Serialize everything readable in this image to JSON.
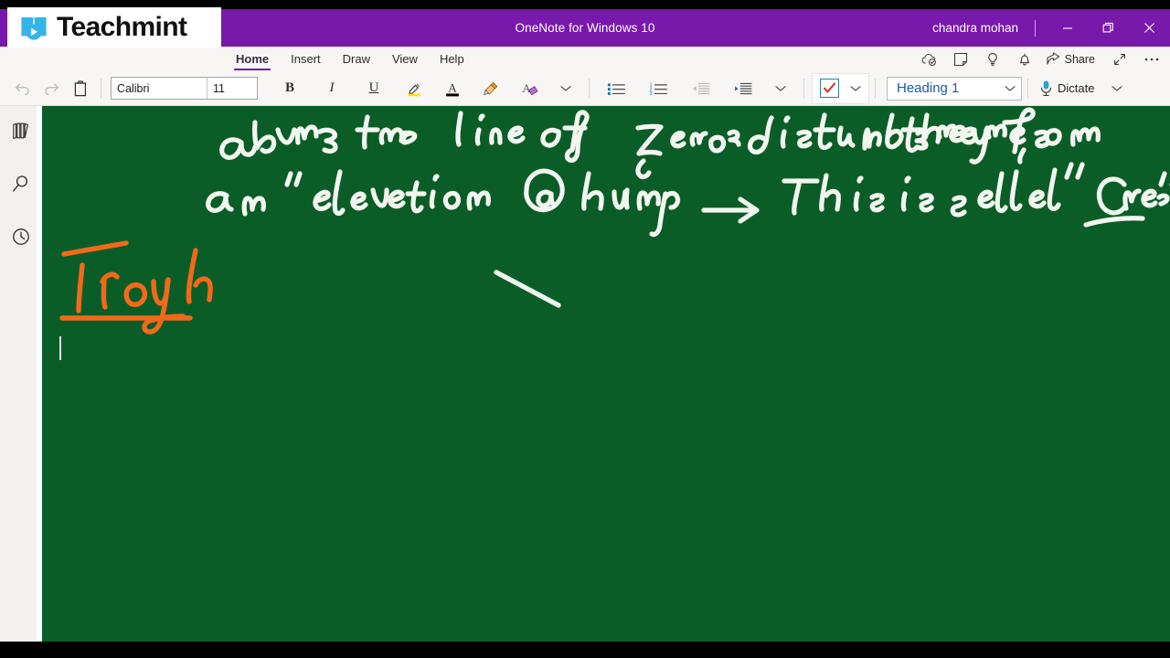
{
  "window": {
    "title": "OneNote for Windows 10",
    "account": "chandra mohan",
    "minimize_label": "Minimize",
    "restore_label": "Restore",
    "close_label": "Close"
  },
  "brand": {
    "name": "Teachmint",
    "logo_icon": "book-play-icon"
  },
  "ribbon": {
    "tabs": [
      {
        "label": "Home",
        "active": true
      },
      {
        "label": "Insert",
        "active": false
      },
      {
        "label": "Draw",
        "active": false
      },
      {
        "label": "View",
        "active": false
      },
      {
        "label": "Help",
        "active": false
      }
    ],
    "right_actions": [
      {
        "label": "Sync",
        "icon": "cloud-sync-icon"
      },
      {
        "label": "Sticky Notes",
        "icon": "sticky-note-icon"
      },
      {
        "label": "Tell me what you want to do",
        "icon": "lightbulb-icon"
      },
      {
        "label": "Notifications",
        "icon": "bell-icon"
      }
    ],
    "share_label": "Share",
    "share_icon": "share-icon",
    "expand_icon": "expand-arrow-icon",
    "more_icon": "ellipsis-icon"
  },
  "toolbar": {
    "undo": {
      "label": "Undo",
      "icon": "undo-icon",
      "enabled": false
    },
    "redo": {
      "label": "Redo",
      "icon": "redo-icon",
      "enabled": false
    },
    "paste": {
      "label": "Paste",
      "icon": "clipboard-icon"
    },
    "font_name": "Calibri",
    "font_size": "11",
    "bold": "B",
    "italic": "I",
    "underline": "U",
    "highlight": {
      "label": "Text Highlight Color",
      "icon": "highlighter-icon",
      "color": "#ffe400"
    },
    "font_color": {
      "label": "Font Color",
      "icon": "font-color-icon",
      "color": "#000000"
    },
    "format_painter": {
      "label": "Format Painter",
      "icon": "format-painter-icon",
      "color": "#e09a2b"
    },
    "clear_formatting": {
      "label": "Clear Formatting",
      "icon": "clear-formatting-icon",
      "color": "#8b3fa8"
    },
    "font_more": "More font options",
    "bullets": {
      "label": "Bullets",
      "icon": "bullet-list-icon"
    },
    "numbering": {
      "label": "Numbering",
      "icon": "numbered-list-icon"
    },
    "decrease_indent": {
      "label": "Decrease Indent",
      "icon": "decrease-indent-icon",
      "enabled": false
    },
    "increase_indent": {
      "label": "Increase Indent",
      "icon": "increase-indent-icon",
      "enabled": true
    },
    "paragraph_more": "More paragraph options",
    "todo_tag": {
      "label": "To Do Tag",
      "icon": "checkbox-check-icon",
      "check_color": "#d9342b",
      "box_color": "#2e7d9a"
    },
    "tags_more": "More tags",
    "style": "Heading 1",
    "style_more": "Styles dropdown",
    "dictate": {
      "label": "Dictate",
      "icon": "microphone-icon"
    },
    "dictate_more": "Dictate options"
  },
  "rail": {
    "items": [
      {
        "label": "Notebooks",
        "icon": "notebooks-icon"
      },
      {
        "label": "Search",
        "icon": "search-icon"
      },
      {
        "label": "Recent Notes",
        "icon": "clock-icon"
      }
    ]
  },
  "canvas": {
    "background_color": "#0b5d28",
    "ink_white": "#f2f6ef",
    "ink_orange": "#f2691a",
    "notes": [
      {
        "line": 1,
        "text": "above the line of zero disturbance, they form",
        "color": "#f2f6ef"
      },
      {
        "line": 2,
        "text": "an \"elevation (a) hump → This is called \"Crest\"",
        "color": "#f2f6ef"
      },
      {
        "line": 3,
        "text": "Trough",
        "color": "#f2691a"
      }
    ],
    "cursor_visible": true
  }
}
